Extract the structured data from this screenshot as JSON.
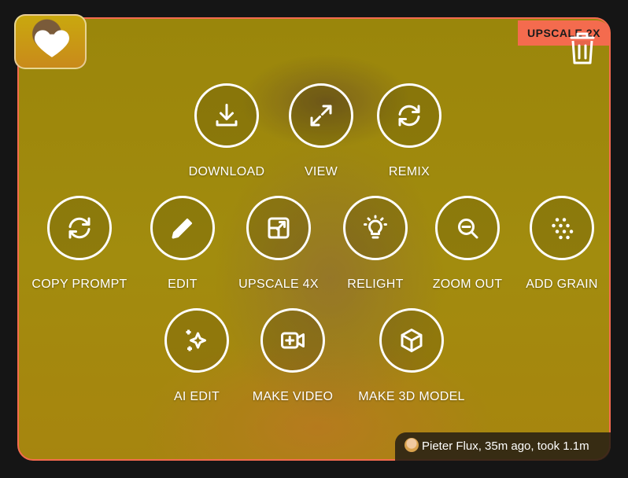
{
  "badge": "UPSCALE 2X",
  "icons": {
    "favorite": "heart-icon",
    "delete": "trash-icon"
  },
  "actions": [
    {
      "label": "DOWNLOAD",
      "icon": "download-icon"
    },
    {
      "label": "VIEW",
      "icon": "expand-icon"
    },
    {
      "label": "REMIX",
      "icon": "refresh-icon"
    },
    {
      "label": "COPY PROMPT",
      "icon": "refresh-icon"
    },
    {
      "label": "EDIT",
      "icon": "pencil-icon"
    },
    {
      "label": "UPSCALE 4X",
      "icon": "upscale-icon"
    },
    {
      "label": "RELIGHT",
      "icon": "lightbulb-icon"
    },
    {
      "label": "ZOOM OUT",
      "icon": "zoom-out-icon"
    },
    {
      "label": "ADD GRAIN",
      "icon": "grain-icon"
    },
    {
      "label": "AI EDIT",
      "icon": "sparkles-icon"
    },
    {
      "label": "MAKE VIDEO",
      "icon": "video-plus-icon"
    },
    {
      "label": "MAKE 3D MODEL",
      "icon": "cube-icon"
    }
  ],
  "footer": {
    "text": "Pieter Flux, 35m ago, took 1.1m"
  },
  "colors": {
    "accent": "#f46b4e",
    "background": "#151515",
    "image_tint": "#b19a10"
  }
}
